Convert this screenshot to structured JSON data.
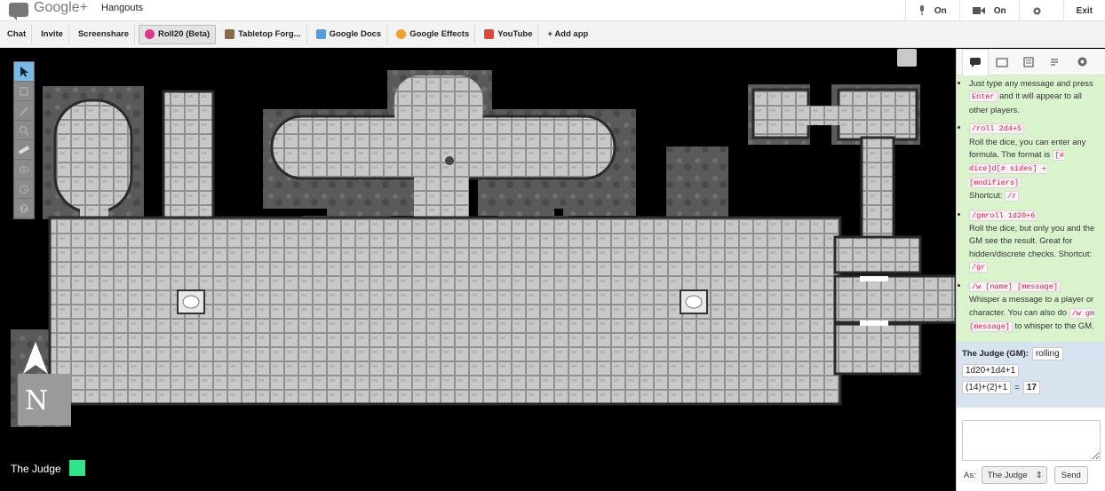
{
  "titlebar": {
    "brand": "Google+",
    "product": "Hangouts",
    "mic_label": "On",
    "cam_label": "On",
    "exit_label": "Exit"
  },
  "appbar": {
    "items": [
      {
        "label": "Chat"
      },
      {
        "label": "Invite"
      },
      {
        "label": "Screenshare"
      },
      {
        "label": "Roll20 (Beta)"
      },
      {
        "label": "Tabletop Forg..."
      },
      {
        "label": "Google Docs"
      },
      {
        "label": "Google Effects"
      },
      {
        "label": "YouTube"
      },
      {
        "label": "+ Add app"
      }
    ]
  },
  "stage": {
    "player_name": "The Judge",
    "player_color": "#33e38a"
  },
  "help": {
    "intro_1": "Just type any message and press",
    "intro_key": "Enter",
    "intro_2": "and it will appear to all other players.",
    "roll_cmd": "/roll 2d4+5",
    "roll_text": "Roll the dice, you can enter any formula. The format is",
    "roll_format": "[# dice]d[# sides] + [modifiers]",
    "roll_short_label": "Shortcut:",
    "roll_short": "/r",
    "gmroll_cmd": "/gmroll 1d20+6",
    "gmroll_text": "Roll the dice, but only you and the GM see the result. Great for hidden/discrete checks. Shortcut:",
    "gmroll_short": "/gr",
    "whisper_cmd": "/w [name] [message]",
    "whisper_text": "Whisper a message to a player or character. You can also do",
    "whisper_gm": "/w gm [message]",
    "whisper_text2": "to whisper to the GM."
  },
  "gm_message": {
    "sender": "The Judge (GM):",
    "word": "rolling",
    "formula": "1d20+1d4+1",
    "breakdown": "(14)+(2)+1",
    "equals": "=",
    "result": "17"
  },
  "chat": {
    "as_label": "As:",
    "as_value": "The Judge",
    "send_label": "Send"
  }
}
